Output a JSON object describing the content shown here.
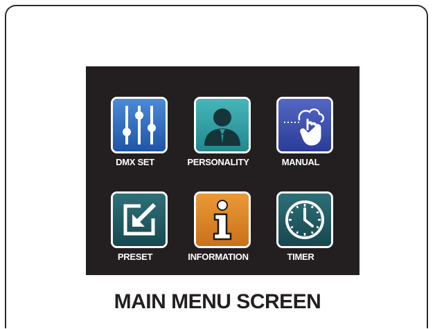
{
  "menu": {
    "items": [
      {
        "label": "DMX SET",
        "icon": "sliders-icon",
        "color": "#2e6fc0"
      },
      {
        "label": "PERSONALITY",
        "icon": "person-icon",
        "color": "#2a9fa3"
      },
      {
        "label": "MANUAL",
        "icon": "touch-hand-icon",
        "color": "#3a4fb0"
      },
      {
        "label": "PRESET",
        "icon": "edit-arrow-icon",
        "color": "#1e5a62"
      },
      {
        "label": "INFORMATION",
        "icon": "info-icon",
        "color": "#d9821f"
      },
      {
        "label": "TIMER",
        "icon": "clock-icon",
        "color": "#1f5a63"
      }
    ]
  },
  "caption": "MAIN MENU SCREEN"
}
